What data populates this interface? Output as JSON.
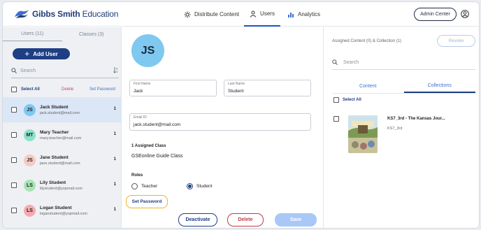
{
  "header": {
    "logo_bold": "Gibbs Smith",
    "logo_light": " Education",
    "nav": [
      {
        "label": "Distribute Content",
        "icon": "gear-icon"
      },
      {
        "label": "Users",
        "icon": "user-icon"
      },
      {
        "label": "Analytics",
        "icon": "bar-chart-icon"
      }
    ],
    "admin_label": "Admin Center"
  },
  "left": {
    "tabs": [
      "Users (11)",
      "Classes (3)"
    ],
    "add_user": "Add User",
    "search_placeholder": "Search",
    "select_all": "Select All",
    "delete": "Delete",
    "set_password": "Set Password",
    "users": [
      {
        "initials": "JS",
        "name": "Jack Student",
        "email": "jack.student@mail.com",
        "count": "1",
        "color": "#7fc8f0"
      },
      {
        "initials": "MT",
        "name": "Mary Teacher",
        "email": "mary.teacher@mail.com",
        "count": "1",
        "color": "#8ce0c8"
      },
      {
        "initials": "JS",
        "name": "Jane Student",
        "email": "jane.student@mail.com",
        "count": "1",
        "color": "#f7c9c3"
      },
      {
        "initials": "LS",
        "name": "Lily Student",
        "email": "lilystudent@yopmail.com",
        "count": "1",
        "color": "#a8e3b5"
      },
      {
        "initials": "LS",
        "name": "Logan Student",
        "email": "loganstudent@yopmail.com",
        "count": "1",
        "color": "#f4a9b0"
      }
    ]
  },
  "detail": {
    "initials": "JS",
    "first_name_label": "First Name",
    "first_name": "Jack",
    "last_name_label": "Last Name",
    "last_name": "Student",
    "email_label": "Email ID",
    "email": "jack.student@mail.com",
    "assigned_class_title": "1 Assigned Class",
    "assigned_class": "GSEonline Guide Class",
    "roles_title": "Roles",
    "role_teacher": "Teacher",
    "role_student": "Student",
    "set_password": "Set Password",
    "deactivate": "Deactivate",
    "delete": "Delete",
    "save": "Save"
  },
  "right": {
    "assigned": "Assigned Content (0) & Collection (1)",
    "revoke": "Revoke",
    "search_placeholder": "Search",
    "tabs": [
      "Content",
      "Collections"
    ],
    "select_all": "Select All",
    "collection_title": "KS7_3rd - The Kansas Jour...",
    "collection_sub": "KS7_3rd"
  }
}
